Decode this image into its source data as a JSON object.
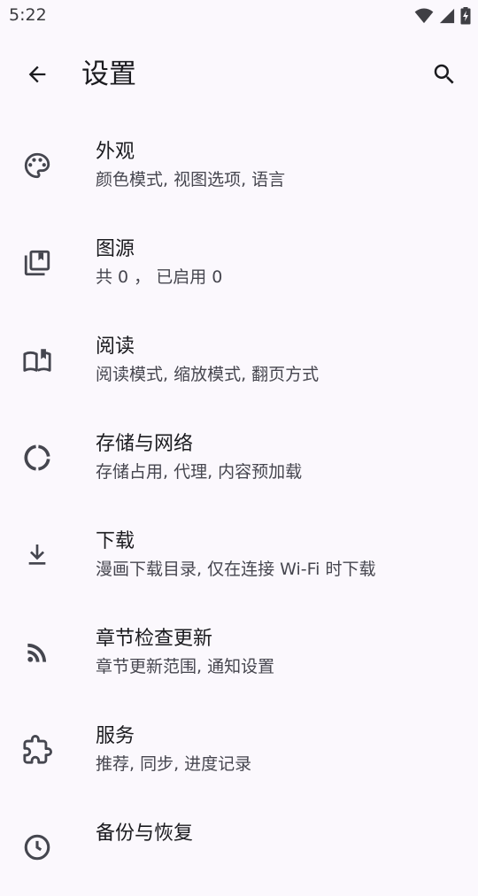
{
  "status_bar": {
    "time": "5:22",
    "icons": [
      "wifi-icon",
      "cell-signal-icon",
      "battery-charging-icon"
    ]
  },
  "app_bar": {
    "title": "设置",
    "back_icon": "arrow-back-icon",
    "search_icon": "search-icon"
  },
  "settings": {
    "items": [
      {
        "icon": "palette-icon",
        "title": "外观",
        "subtitle": "颜色模式, 视图选项, 语言"
      },
      {
        "icon": "library-books-icon",
        "title": "图源",
        "subtitle": "共 0 ， 已启用 0"
      },
      {
        "icon": "open-book-icon",
        "title": "阅读",
        "subtitle": "阅读模式, 缩放模式, 翻页方式"
      },
      {
        "icon": "sync-ring-icon",
        "title": "存储与网络",
        "subtitle": "存储占用, 代理, 内容预加载"
      },
      {
        "icon": "download-icon",
        "title": "下载",
        "subtitle": "漫画下载目录, 仅在连接 Wi-Fi 时下载"
      },
      {
        "icon": "rss-feed-icon",
        "title": "章节检查更新",
        "subtitle": "章节更新范围, 通知设置"
      },
      {
        "icon": "extension-icon",
        "title": "服务",
        "subtitle": "推荐, 同步, 进度记录"
      },
      {
        "icon": "backup-restore-icon",
        "title": "备份与恢复",
        "subtitle": ""
      }
    ]
  },
  "colors": {
    "background": "#FBF8FD",
    "text_primary": "#1B1B1F",
    "text_secondary": "#46464F",
    "icon": "#45464F"
  }
}
